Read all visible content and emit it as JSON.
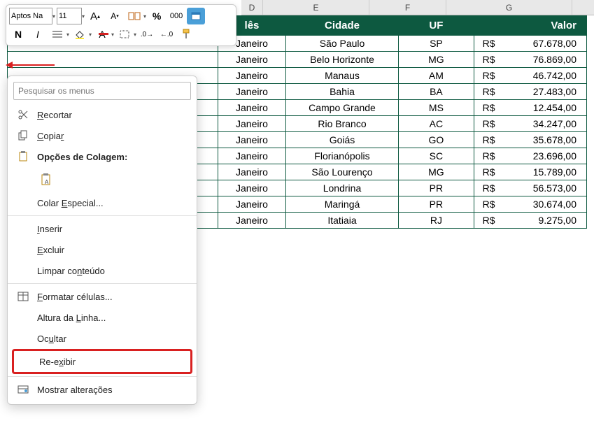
{
  "toolbar": {
    "font": "Aptos Na",
    "size": "11",
    "boldLabel": "N",
    "italicLabel": "I"
  },
  "columns": {
    "d": "D",
    "e": "E",
    "f": "F",
    "g": "G"
  },
  "table": {
    "headers": {
      "mes": "lês",
      "cidade": "Cidade",
      "uf": "UF",
      "valor": "Valor"
    },
    "currencySymbol": "R$",
    "rows": [
      {
        "mes": "Janeiro",
        "cidade": "São Paulo",
        "uf": "SP",
        "valor": "67.678,00"
      },
      {
        "mes": "Janeiro",
        "cidade": "Belo Horizonte",
        "uf": "MG",
        "valor": "76.869,00"
      },
      {
        "mes": "Janeiro",
        "cidade": "Manaus",
        "uf": "AM",
        "valor": "46.742,00"
      },
      {
        "mes": "Janeiro",
        "cidade": "Bahia",
        "uf": "BA",
        "valor": "27.483,00"
      },
      {
        "mes": "Janeiro",
        "cidade": "Campo Grande",
        "uf": "MS",
        "valor": "12.454,00"
      },
      {
        "mes": "Janeiro",
        "cidade": "Rio Branco",
        "uf": "AC",
        "valor": "34.247,00"
      },
      {
        "mes": "Janeiro",
        "cidade": "Goiás",
        "uf": "GO",
        "valor": "35.678,00"
      },
      {
        "mes": "Janeiro",
        "cidade": "Florianópolis",
        "uf": "SC",
        "valor": "23.696,00"
      },
      {
        "mes": "Janeiro",
        "cidade": "São Lourenço",
        "uf": "MG",
        "valor": "15.789,00"
      },
      {
        "mes": "Janeiro",
        "cidade": "Londrina",
        "uf": "PR",
        "valor": "56.573,00"
      },
      {
        "mes": "Janeiro",
        "cidade": "Maringá",
        "uf": "PR",
        "valor": "30.674,00"
      },
      {
        "mes": "Janeiro",
        "cidade": "Itatiaia",
        "uf": "RJ",
        "valor": "9.275,00"
      }
    ]
  },
  "contextMenu": {
    "searchPlaceholder": "Pesquisar os menus",
    "cut": "Recortar",
    "copy": "Copiar",
    "pasteOptions": "Opções de Colagem:",
    "pasteSpecial": "Colar Especial...",
    "insert": "Inserir",
    "delete": "Excluir",
    "clearContents": "Limpar conteúdo",
    "formatCells": "Formatar células...",
    "rowHeight": "Altura da Linha...",
    "hide": "Ocultar",
    "unhide": "Re-exibir",
    "showChanges": "Mostrar alterações"
  }
}
